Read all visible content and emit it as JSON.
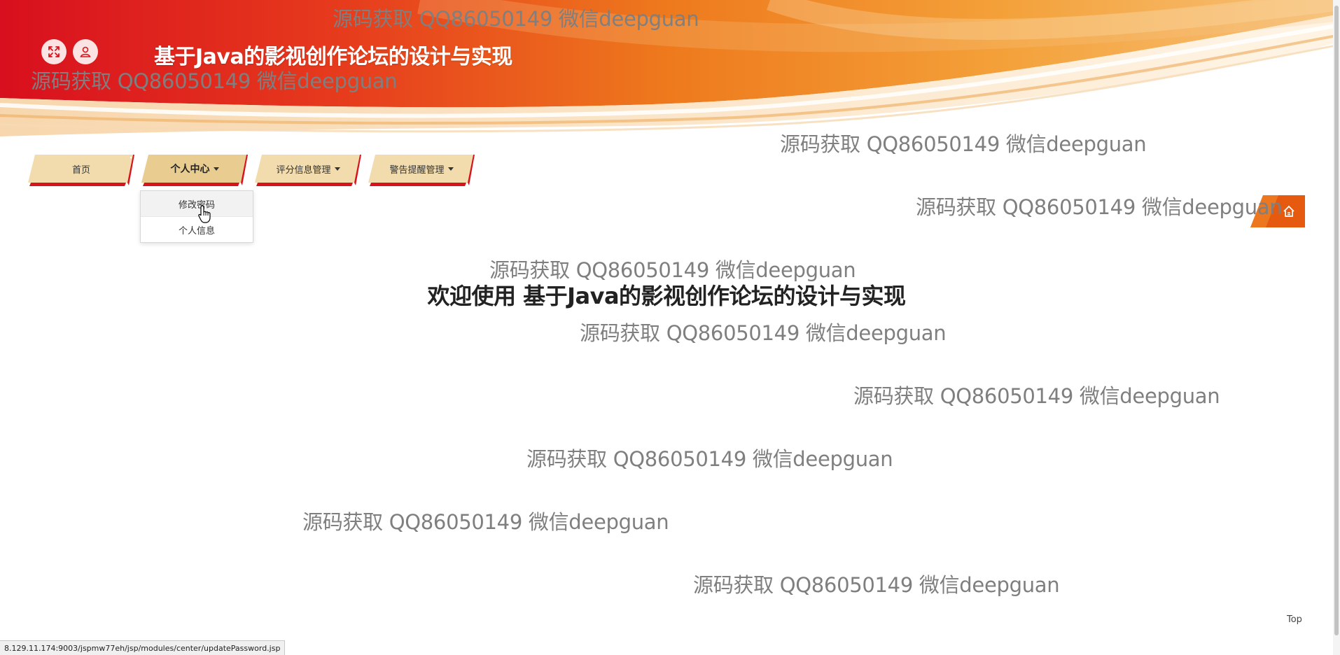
{
  "header": {
    "title": "基于Java的影视创作论坛的设计与实现",
    "icons": [
      "fullscreen-icon",
      "user-icon"
    ]
  },
  "nav": {
    "items": [
      {
        "label": "首页",
        "has_dropdown": false
      },
      {
        "label": "个人中心",
        "has_dropdown": true,
        "active": true
      },
      {
        "label": "评分信息管理",
        "has_dropdown": true
      },
      {
        "label": "警告提醒管理",
        "has_dropdown": true
      }
    ]
  },
  "dropdown": {
    "items": [
      {
        "label": "修改密码"
      },
      {
        "label": "个人信息"
      }
    ]
  },
  "home_button": {
    "icon": "home-icon"
  },
  "main": {
    "welcome": "欢迎使用 基于Java的影视创作论坛的设计与实现"
  },
  "watermark_text": "源码获取 QQ86050149 微信deepguan",
  "footer": {
    "top_link": "Top"
  },
  "status_bar": {
    "url": "8.129.11.174:9003/jspmw77eh/jsp/modules/center/updatePassword.jsp"
  },
  "colors": {
    "banner_red": "#d9141f",
    "banner_orange": "#ef8a1c",
    "tab_fill": "#f2dcae",
    "tab_accent": "#d7131c",
    "home_orange": "#e65a10"
  }
}
